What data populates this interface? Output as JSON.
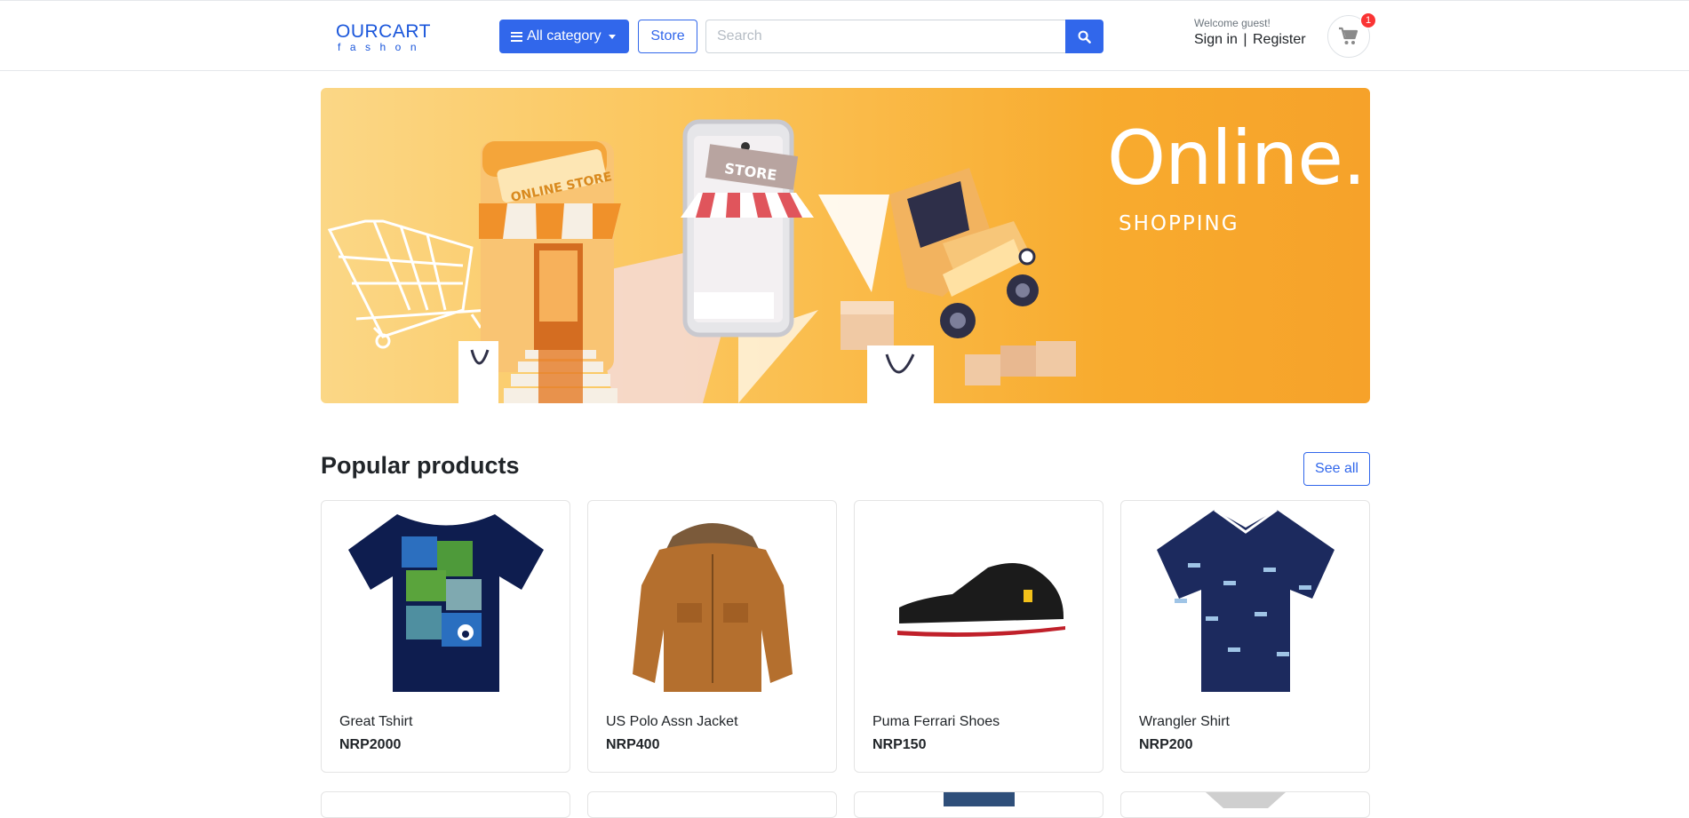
{
  "header": {
    "logo_brand": "OURCART",
    "logo_sub": "fashon",
    "category_label": "All category",
    "store_label": "Store",
    "search_placeholder": "Search",
    "welcome_text": "Welcome guest!",
    "signin_label": "Sign in",
    "separator": "|",
    "register_label": "Register",
    "cart_count": "1"
  },
  "banner": {
    "title": "Online.",
    "subtitle": "SHOPPING"
  },
  "popular": {
    "title": "Popular products",
    "see_all_label": "See all",
    "products": [
      {
        "name": "Great Tshirt",
        "price": "NRP2000",
        "icon": "tshirt-image"
      },
      {
        "name": "US Polo Assn Jacket",
        "price": "NRP400",
        "icon": "jacket-image"
      },
      {
        "name": "Puma Ferrari Shoes",
        "price": "NRP150",
        "icon": "shoes-image"
      },
      {
        "name": "Wrangler Shirt",
        "price": "NRP200",
        "icon": "shirt-image"
      }
    ]
  },
  "colors": {
    "primary": "#3167eb",
    "badge": "#fa3434",
    "banner_orange": "#f8ab2e"
  }
}
